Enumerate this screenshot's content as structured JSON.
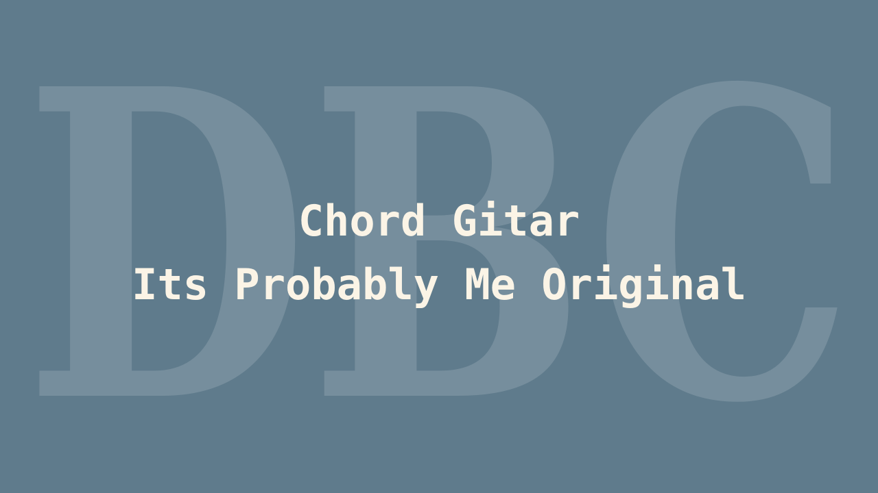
{
  "watermark": {
    "text": "DBC",
    "color": "#ffffff"
  },
  "title": {
    "line1": "Chord Gitar",
    "line2": "Its Probably Me Original"
  },
  "colors": {
    "background": "#5f7b8c",
    "title_text": "#fbf4e6"
  }
}
